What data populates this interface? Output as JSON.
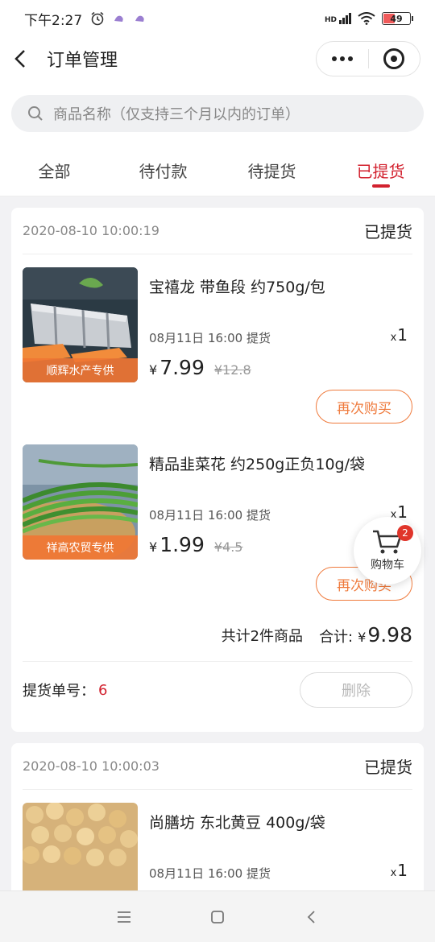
{
  "status_bar": {
    "time": "下午2:27",
    "network": "HD",
    "battery": "49"
  },
  "nav": {
    "title": "订单管理"
  },
  "search": {
    "placeholder": "商品名称（仅支持三个月以内的订单）"
  },
  "tabs": [
    {
      "label": "全部",
      "active": false
    },
    {
      "label": "待付款",
      "active": false
    },
    {
      "label": "待提货",
      "active": false
    },
    {
      "label": "已提货",
      "active": true
    }
  ],
  "orders": [
    {
      "date": "2020-08-10 10:00:19",
      "status": "已提货",
      "items": [
        {
          "name": "宝禧龙 带鱼段 约750g/包",
          "supplier": "顺辉水产专供",
          "pickup": "08月11日 16:00 提货",
          "qty_prefix": "x",
          "qty": "1",
          "currency": "¥",
          "price": "7.99",
          "old_price": "¥12.8",
          "rebuy": "再次购买"
        },
        {
          "name": "精品韭菜花 约250g正负10g/袋",
          "supplier": "祥高农贸专供",
          "pickup": "08月11日 16:00 提货",
          "qty_prefix": "x",
          "qty": "1",
          "currency": "¥",
          "price": "1.99",
          "old_price": "¥4.5",
          "rebuy": "再次购买"
        }
      ],
      "summary_count": "共计2件商品",
      "summary_label": "合计:",
      "summary_currency": "¥",
      "summary_total": "9.98",
      "pick_label": "提货单号：",
      "pick_number": "6",
      "delete_label": "删除"
    },
    {
      "date": "2020-08-10 10:00:03",
      "status": "已提货",
      "items": [
        {
          "name": "尚膳坊 东北黄豆 400g/袋",
          "pickup": "08月11日 16:00 提货",
          "qty_prefix": "x",
          "qty": "1"
        }
      ]
    }
  ],
  "cart": {
    "label": "购物车",
    "badge": "2"
  },
  "colors": {
    "accent": "#d2212e",
    "orange": "#ef7a3c"
  }
}
